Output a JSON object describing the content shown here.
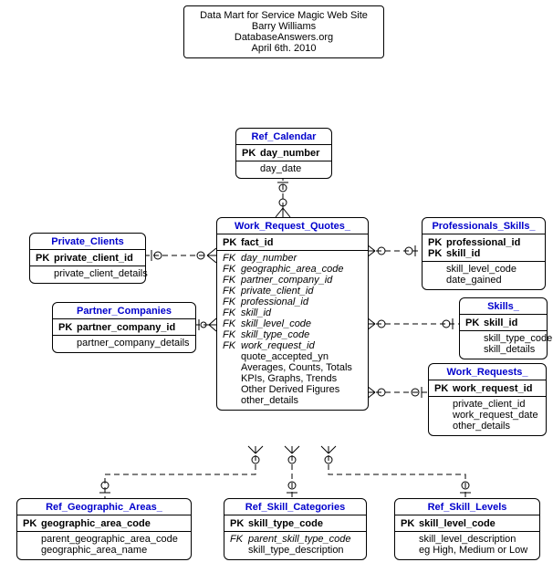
{
  "title": {
    "line1": "Data Mart for Service Magic Web Site",
    "line2": "Barry Williams",
    "line3": "DatabaseAnswers.org",
    "line4": "April 6th. 2010"
  },
  "entities": {
    "ref_calendar": {
      "name": "Ref_Calendar",
      "pk1": "day_number",
      "a1": "day_date"
    },
    "private_clients": {
      "name": "Private_Clients",
      "pk1": "private_client_id",
      "a1": "private_client_details"
    },
    "partner_companies": {
      "name": "Partner_Companies",
      "pk1": "partner_company_id",
      "a1": "partner_company_details"
    },
    "work_request_quotes": {
      "name": "Work_Request_Quotes_",
      "pk1": "fact_id",
      "fk1": "day_number",
      "fk2": "geographic_area_code",
      "fk3": "partner_company_id",
      "fk4": "private_client_id",
      "fk5": "professional_id",
      "fk6": "skill_id",
      "fk7": "skill_level_code",
      "fk8": "skill_type_code",
      "fk9": "work_request_id",
      "a1": "quote_accepted_yn",
      "a2": "Averages, Counts, Totals",
      "a3": "KPIs, Graphs, Trends",
      "a4": "Other Derived Figures",
      "a5": "other_details"
    },
    "professionals_skills": {
      "name": "Professionals_Skills_",
      "pk1": "professional_id",
      "pk2": "skill_id",
      "a1": "skill_level_code",
      "a2": "date_gained"
    },
    "skills": {
      "name": "Skills_",
      "pk1": "skill_id",
      "a1": "skill_type_code",
      "a2": "skill_details"
    },
    "work_requests": {
      "name": "Work_Requests_",
      "pk1": "work_request_id",
      "a1": "private_client_id",
      "a2": "work_request_date",
      "a3": "other_details"
    },
    "ref_geographic_areas": {
      "name": "Ref_Geographic_Areas_",
      "pk1": "geographic_area_code",
      "a1": "parent_geographic_area_code",
      "a2": "geographic_area_name"
    },
    "ref_skill_categories": {
      "name": "Ref_Skill_Categories",
      "pk1": "skill_type_code",
      "fk1": "parent_skill_type_code",
      "a1": "skill_type_description"
    },
    "ref_skill_levels": {
      "name": "Ref_Skill_Levels",
      "pk1": "skill_level_code",
      "a1": "skill_level_description",
      "a2": "eg High, Medium or Low"
    }
  },
  "labels": {
    "PK": "PK",
    "FK": "FK"
  }
}
